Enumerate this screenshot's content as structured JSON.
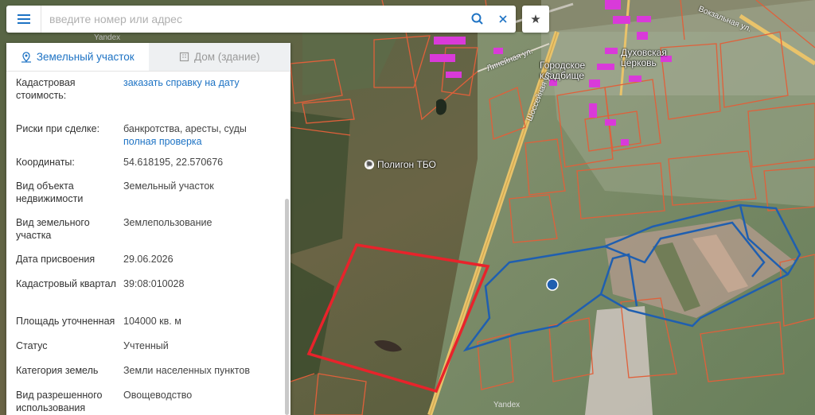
{
  "search": {
    "placeholder": "введите номер или адрес"
  },
  "tabs": [
    {
      "label": "Земельный участок",
      "active": true,
      "icon": "land-plot-icon"
    },
    {
      "label": "Дом (здание)",
      "active": false,
      "icon": "building-icon"
    }
  ],
  "details": {
    "cadastral_value": {
      "label": "Кадастровая стоимость:",
      "link": "заказать справку на дату"
    },
    "risks": {
      "label": "Риски при сделке:",
      "value": "банкротства, аресты, суды",
      "link": "полная проверка"
    },
    "coords": {
      "label": "Координаты:",
      "value": "54.618195, 22.570676"
    },
    "object_type": {
      "label": "Вид объекта недвижимости",
      "value": "Земельный участок"
    },
    "plot_type": {
      "label": "Вид земельного участка",
      "value": "Землепользование"
    },
    "assign_date": {
      "label": "Дата присвоения",
      "value": "29.06.2026"
    },
    "quarter": {
      "label": "Кадастровый квартал",
      "value": "39:08:010028"
    },
    "area": {
      "label": "Площадь уточненная",
      "value": "104000 кв. м"
    },
    "status": {
      "label": "Статус",
      "value": "Учтенный"
    },
    "category": {
      "label": "Категория земель",
      "value": "Земли населенных пунктов"
    },
    "usage": {
      "label": "Вид разрешенного использования",
      "value": "Овощеводство"
    }
  },
  "map": {
    "labels": {
      "landfill": "Полигон ТБО",
      "cemetery": "Городское кладбище",
      "church": "Духовская церковь",
      "street_shosse": "Шоссейная ул.",
      "street_lineinaya": "Линейная ул.",
      "street_vokzalnaya": "Вокзальная ул.",
      "watermark_top": "Yandex",
      "watermark_bottom": "Yandex"
    },
    "colors": {
      "selected_parcel": "#e8232b",
      "blue_outline": "#1f5fb0",
      "parcel_lines": "#e0603a",
      "buildings": "#d93ad9"
    }
  }
}
